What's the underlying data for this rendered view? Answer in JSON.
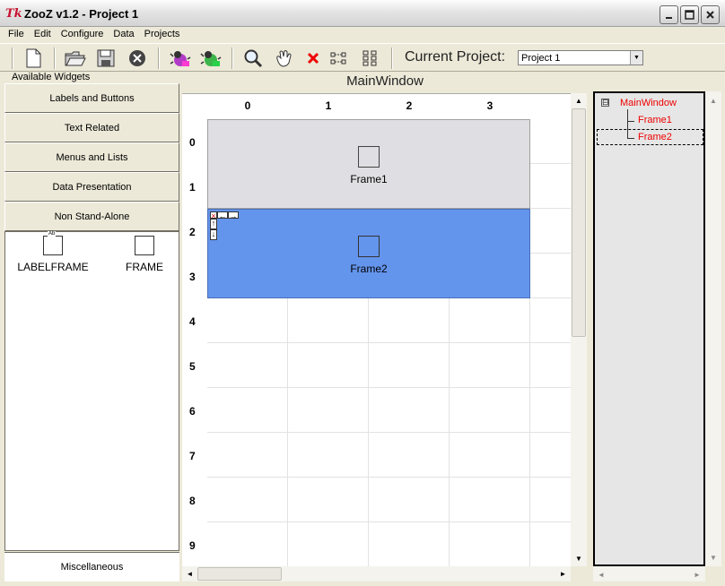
{
  "window": {
    "icon_text": "Tk",
    "title": "ZooZ v1.2 - Project 1"
  },
  "menu": [
    "File",
    "Edit",
    "Configure",
    "Data",
    "Projects"
  ],
  "toolbar": {
    "buttons": [
      "new-file-icon",
      "open-folder-icon",
      "save-disk-icon",
      "close-project-icon",
      "bug-icon",
      "run-icon",
      "zoom-icon",
      "hand-icon",
      "delete-icon",
      "align-icon",
      "grid-icon"
    ],
    "project_label": "Current Project:",
    "project_value": "Project 1"
  },
  "left_panel": {
    "group_label": "Available Widgets",
    "categories": [
      "Labels and Buttons",
      "Text Related",
      "Menus and Lists",
      "Data Presentation",
      "Non Stand-Alone"
    ],
    "widgets": [
      {
        "label": "LABELFRAME",
        "icon_text": "Ab"
      },
      {
        "label": "FRAME"
      }
    ],
    "misc_label": "Miscellaneous"
  },
  "canvas": {
    "title": "MainWindow",
    "columns": [
      "0",
      "1",
      "2",
      "3"
    ],
    "rows": [
      "0",
      "1",
      "2",
      "3",
      "4",
      "5",
      "6",
      "7",
      "8",
      "9"
    ],
    "frames": [
      {
        "name": "Frame1",
        "color": "#dfdfe3"
      },
      {
        "name": "Frame2",
        "color": "#6495ed"
      }
    ]
  },
  "tree": {
    "root": "MainWindow",
    "children": [
      "Frame1",
      "Frame2"
    ],
    "selected": "Frame2",
    "expander": "⊟"
  }
}
